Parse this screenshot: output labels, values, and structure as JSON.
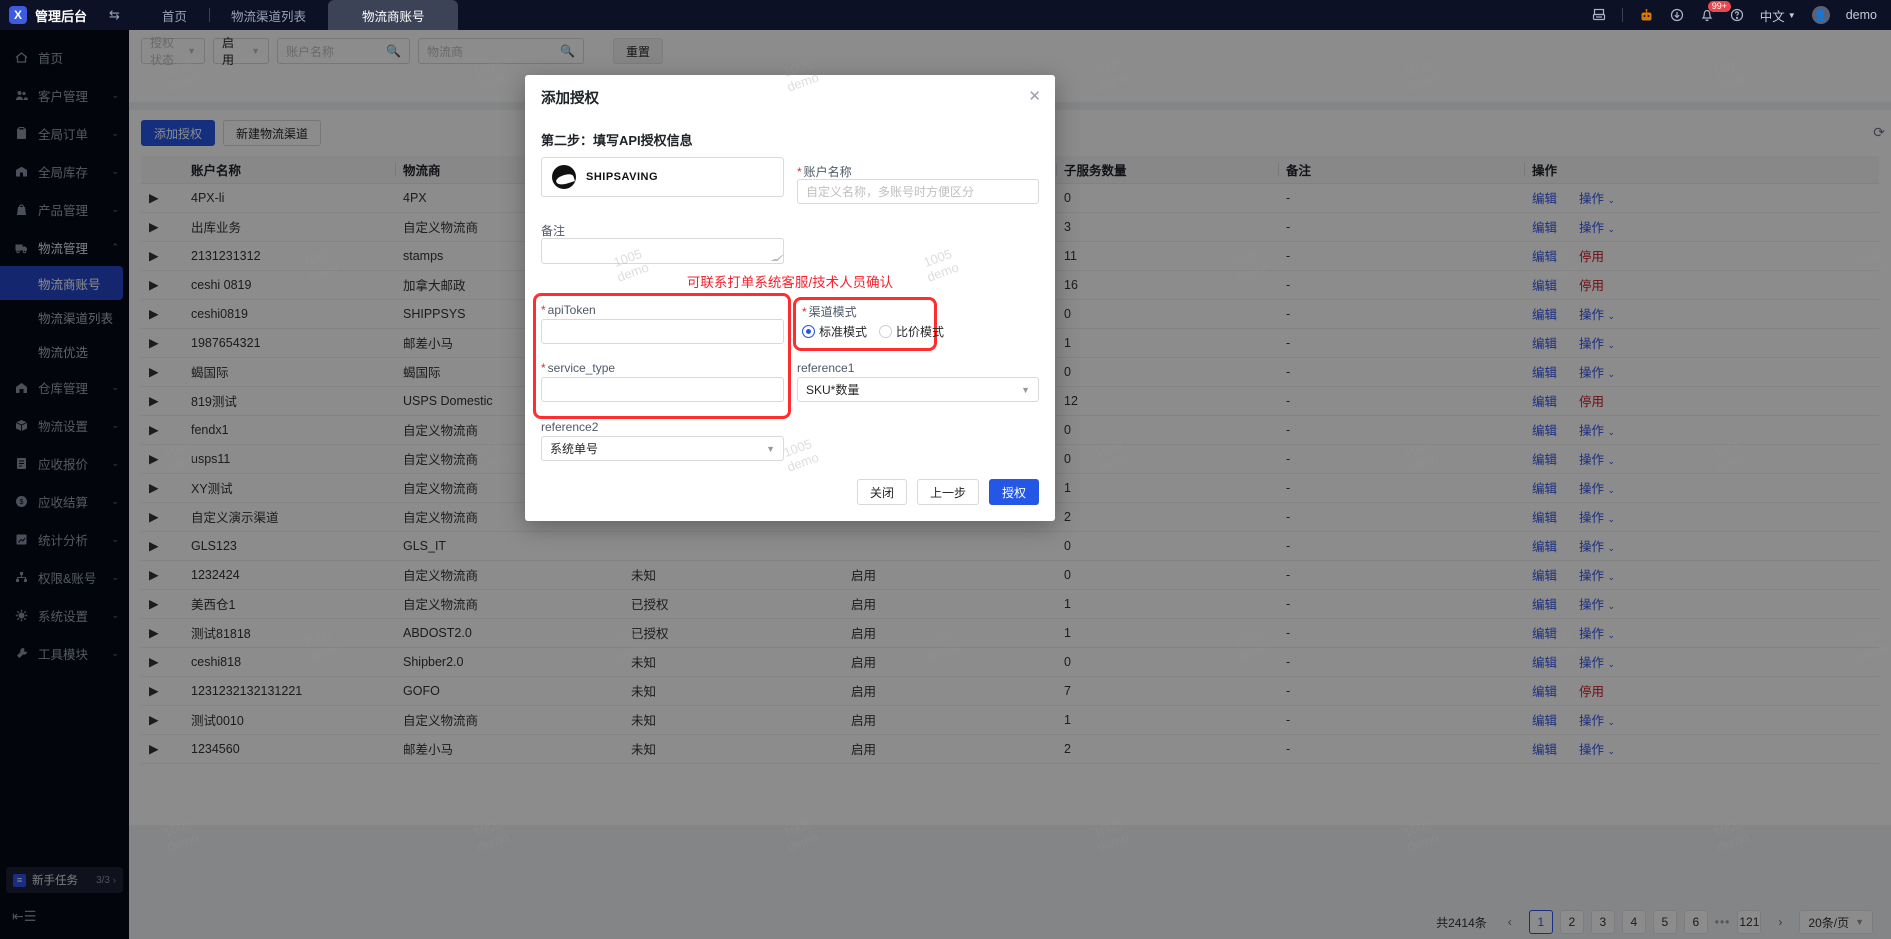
{
  "watermark": {
    "line1": "1005",
    "line2": "demo"
  },
  "topbar": {
    "app_title": "管理后台",
    "tabs": [
      {
        "label": "首页",
        "active": false
      },
      {
        "label": "物流渠道列表",
        "active": false
      },
      {
        "label": "物流商账号",
        "active": true
      }
    ],
    "notification_badge": "99+",
    "language": "中文",
    "username": "demo"
  },
  "sidebar": {
    "items": [
      {
        "label": "首页",
        "icon": "home-icon",
        "chevron": false
      },
      {
        "label": "客户管理",
        "icon": "customers-icon",
        "chevron": true
      },
      {
        "label": "全局订单",
        "icon": "orders-icon",
        "chevron": true
      },
      {
        "label": "全局库存",
        "icon": "inventory-icon",
        "chevron": true
      },
      {
        "label": "产品管理",
        "icon": "products-icon",
        "chevron": true
      },
      {
        "label": "物流管理",
        "icon": "logistics-icon",
        "chevron": true,
        "expanded": true,
        "children": [
          {
            "label": "物流商账号",
            "active": true
          },
          {
            "label": "物流渠道列表",
            "active": false
          },
          {
            "label": "物流优选",
            "active": false
          }
        ]
      },
      {
        "label": "仓库管理",
        "icon": "warehouse-icon",
        "chevron": true
      },
      {
        "label": "物流设置",
        "icon": "shipping-settings-icon",
        "chevron": true
      },
      {
        "label": "应收报价",
        "icon": "quote-icon",
        "chevron": true
      },
      {
        "label": "应收结算",
        "icon": "settlement-icon",
        "chevron": true
      },
      {
        "label": "统计分析",
        "icon": "stats-icon",
        "chevron": true
      },
      {
        "label": "权限&账号",
        "icon": "permissions-icon",
        "chevron": true
      },
      {
        "label": "系统设置",
        "icon": "gear-icon",
        "chevron": true
      },
      {
        "label": "工具模块",
        "icon": "tools-icon",
        "chevron": true
      }
    ],
    "task_card": {
      "label": "新手任务",
      "progress": "3/3"
    }
  },
  "filters": {
    "auth_status_placeholder": "授权状态",
    "enabled_value": "启用",
    "account_placeholder": "账户名称",
    "provider_placeholder": "物流商",
    "reset_label": "重置"
  },
  "actions": {
    "add_auth": "添加授权",
    "new_channel": "新建物流渠道"
  },
  "table": {
    "headers": [
      "账户名称",
      "物流商",
      "",
      "",
      "子服务数量",
      "备注",
      "操作"
    ],
    "ops_labels": {
      "edit": "编辑",
      "more": "操作",
      "disable": "停用"
    },
    "rows": [
      {
        "account": "4PX-li",
        "provider": "4PX",
        "auth": "",
        "status": "",
        "count": "0",
        "remark": "-",
        "op": "more"
      },
      {
        "account": "出库业务",
        "provider": "自定义物流商",
        "auth": "",
        "status": "",
        "count": "3",
        "remark": "-",
        "op": "more"
      },
      {
        "account": "2131231312",
        "provider": "stamps",
        "auth": "",
        "status": "",
        "count": "11",
        "remark": "-",
        "op": "disable"
      },
      {
        "account": "ceshi 0819",
        "provider": "加拿大邮政",
        "auth": "",
        "status": "",
        "count": "16",
        "remark": "-",
        "op": "disable"
      },
      {
        "account": "ceshi0819",
        "provider": "SHIPPSYS",
        "auth": "",
        "status": "",
        "count": "0",
        "remark": "-",
        "op": "more"
      },
      {
        "account": "1987654321",
        "provider": "邮差小马",
        "auth": "",
        "status": "",
        "count": "1",
        "remark": "-",
        "op": "more"
      },
      {
        "account": "蝎国际",
        "provider": "蝎国际",
        "auth": "",
        "status": "",
        "count": "0",
        "remark": "-",
        "op": "more"
      },
      {
        "account": "819测试",
        "provider": "USPS Domestic",
        "auth": "",
        "status": "",
        "count": "12",
        "remark": "-",
        "op": "disable"
      },
      {
        "account": "fendx1",
        "provider": "自定义物流商",
        "auth": "",
        "status": "",
        "count": "0",
        "remark": "-",
        "op": "more"
      },
      {
        "account": "usps11",
        "provider": "自定义物流商",
        "auth": "",
        "status": "",
        "count": "0",
        "remark": "-",
        "op": "more"
      },
      {
        "account": "XY测试",
        "provider": "自定义物流商",
        "auth": "",
        "status": "",
        "count": "1",
        "remark": "-",
        "op": "more"
      },
      {
        "account": "自定义演示渠道",
        "provider": "自定义物流商",
        "auth": "",
        "status": "",
        "count": "2",
        "remark": "-",
        "op": "more"
      },
      {
        "account": "GLS123",
        "provider": "GLS_IT",
        "auth": "",
        "status": "",
        "count": "0",
        "remark": "-",
        "op": "more"
      },
      {
        "account": "1232424",
        "provider": "自定义物流商",
        "auth": "未知",
        "status": "启用",
        "count": "0",
        "remark": "-",
        "op": "more"
      },
      {
        "account": "美西仓1",
        "provider": "自定义物流商",
        "auth": "已授权",
        "status": "启用",
        "count": "1",
        "remark": "-",
        "op": "more"
      },
      {
        "account": "测试81818",
        "provider": "ABDOST2.0",
        "auth": "已授权",
        "status": "启用",
        "count": "1",
        "remark": "-",
        "op": "more"
      },
      {
        "account": "ceshi818",
        "provider": "Shipber2.0",
        "auth": "未知",
        "status": "启用",
        "count": "0",
        "remark": "-",
        "op": "more"
      },
      {
        "account": "1231232132131221",
        "provider": "GOFO",
        "auth": "未知",
        "status": "启用",
        "count": "7",
        "remark": "-",
        "op": "disable"
      },
      {
        "account": "测试0010",
        "provider": "自定义物流商",
        "auth": "未知",
        "status": "启用",
        "count": "1",
        "remark": "-",
        "op": "more"
      },
      {
        "account": "1234560",
        "provider": "邮差小马",
        "auth": "未知",
        "status": "启用",
        "count": "2",
        "remark": "-",
        "op": "more"
      }
    ]
  },
  "pagination": {
    "total": "共2414条",
    "pages": [
      "1",
      "2",
      "3",
      "4",
      "5",
      "6"
    ],
    "active_page": "1",
    "ellipsis": "•••",
    "last_page": "121",
    "page_size": "20条/页"
  },
  "modal": {
    "title": "添加授权",
    "step_title": "第二步：填写API授权信息",
    "provider_name": "SHIPSAVING",
    "account_label": "账户名称",
    "account_placeholder": "自定义名称，多账号时方便区分",
    "remark_label": "备注",
    "notice": "可联系打单系统客服/技术人员确认",
    "api_token_label": "apiToken",
    "service_type_label": "service_type",
    "channel_mode_label": "渠道模式",
    "mode_standard": "标准模式",
    "mode_compare": "比价模式",
    "reference1_label": "reference1",
    "reference1_value": "SKU*数量",
    "reference2_label": "reference2",
    "reference2_value": "系统单号",
    "close_label": "关闭",
    "prev_label": "上一步",
    "authorize_label": "授权"
  },
  "colors": {
    "primary": "#2457e6",
    "link": "#2f54eb",
    "danger": "#cf1322",
    "annotation_red": "#ff2d2d",
    "topbar_bg": "#0c1126",
    "sidebar_bg": "#060a18",
    "sidebar_active": "#2648c9"
  }
}
